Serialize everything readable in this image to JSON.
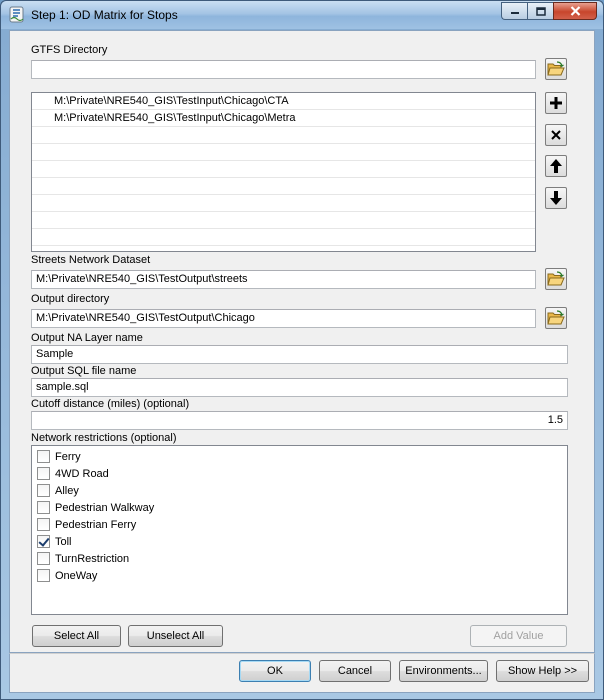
{
  "window": {
    "title": "Step 1: OD Matrix for Stops"
  },
  "gtfs": {
    "label": "GTFS Directory",
    "input_value": "",
    "paths": [
      "M:\\Private\\NRE540_GIS\\TestInput\\Chicago\\CTA",
      "M:\\Private\\NRE540_GIS\\TestInput\\Chicago\\Metra"
    ]
  },
  "streets": {
    "label": "Streets Network Dataset",
    "value": "M:\\Private\\NRE540_GIS\\TestOutput\\streets"
  },
  "output_dir": {
    "label": "Output directory",
    "value": "M:\\Private\\NRE540_GIS\\TestOutput\\Chicago"
  },
  "na_layer": {
    "label": "Output NA Layer name",
    "value": "Sample"
  },
  "sql_file": {
    "label": "Output SQL file name",
    "value": "sample.sql"
  },
  "cutoff": {
    "label": "Cutoff distance (miles) (optional)",
    "value": "1.5"
  },
  "restrictions": {
    "label": "Network restrictions (optional)",
    "items": [
      {
        "label": "Ferry",
        "checked": false
      },
      {
        "label": "4WD Road",
        "checked": false
      },
      {
        "label": "Alley",
        "checked": false
      },
      {
        "label": "Pedestrian Walkway",
        "checked": false
      },
      {
        "label": "Pedestrian Ferry",
        "checked": false
      },
      {
        "label": "Toll",
        "checked": true
      },
      {
        "label": "TurnRestriction",
        "checked": false
      },
      {
        "label": "OneWay",
        "checked": false
      }
    ]
  },
  "buttons": {
    "select_all": "Select All",
    "unselect_all": "Unselect All",
    "add_value": "Add Value",
    "ok": "OK",
    "cancel": "Cancel",
    "environments": "Environments...",
    "show_help": "Show Help >>"
  },
  "icons": {
    "folder": "open-folder-icon",
    "add": "plus-icon",
    "remove": "x-icon",
    "up": "arrow-up-icon",
    "down": "arrow-down-icon"
  }
}
